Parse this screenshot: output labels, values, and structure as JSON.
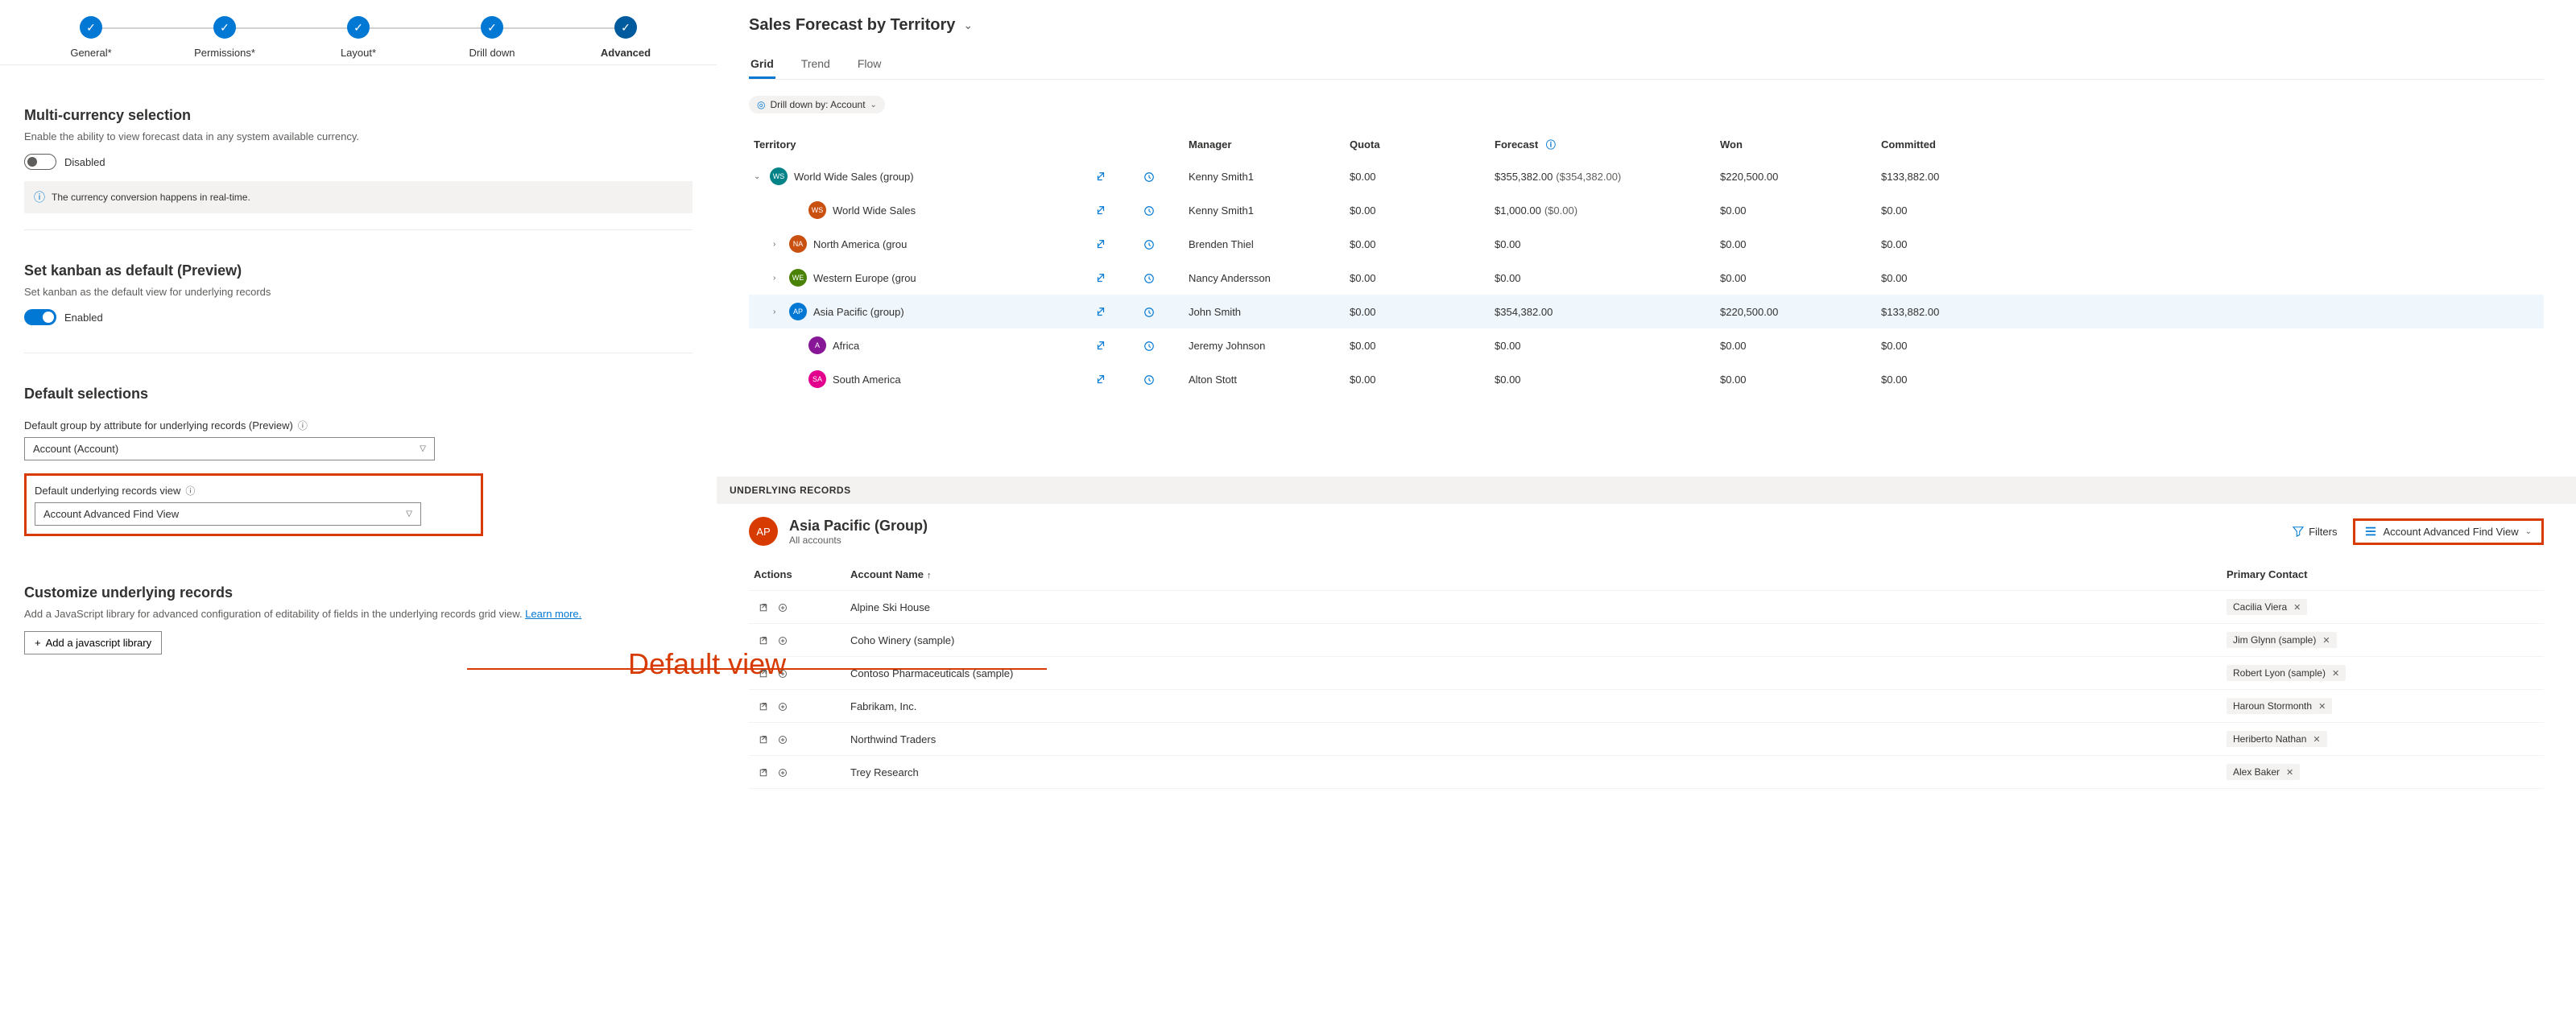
{
  "stepper": {
    "steps": [
      {
        "label": "General*"
      },
      {
        "label": "Permissions*"
      },
      {
        "label": "Layout*"
      },
      {
        "label": "Drill down"
      },
      {
        "label": "Advanced"
      }
    ]
  },
  "multi_currency": {
    "title": "Multi-currency selection",
    "sub": "Enable the ability to view forecast data in any system available currency.",
    "toggle_label": "Disabled",
    "info": "The currency conversion happens in real-time."
  },
  "kanban": {
    "title": "Set kanban as default (Preview)",
    "sub": "Set kanban as the default view for underlying records",
    "toggle_label": "Enabled"
  },
  "default_selections": {
    "title": "Default selections",
    "group_by_label": "Default group by attribute for underlying records (Preview)",
    "group_by_value": "Account (Account)",
    "view_label": "Default underlying records view",
    "view_value": "Account Advanced Find View"
  },
  "customize": {
    "title": "Customize underlying records",
    "sub_a": "Add a JavaScript library for advanced configuration of editability of fields in the underlying records grid view. ",
    "sub_link": "Learn more.",
    "button": "Add a javascript library"
  },
  "annotation": "Default view",
  "forecast": {
    "title": "Sales Forecast by Territory",
    "tabs": [
      {
        "label": "Grid",
        "active": true
      },
      {
        "label": "Trend",
        "active": false
      },
      {
        "label": "Flow",
        "active": false
      }
    ],
    "drill_chip": "Drill down by: Account",
    "columns": {
      "territory": "Territory",
      "manager": "Manager",
      "quota": "Quota",
      "forecast": "Forecast",
      "won": "Won",
      "committed": "Committed"
    },
    "rows": [
      {
        "indent": 1,
        "expand": "down",
        "initials": "WS",
        "avatar_bg": "#038387",
        "name": "World Wide Sales (group)",
        "manager": "Kenny Smith1",
        "quota": "$0.00",
        "forecast": "$355,382.00",
        "forecast2": "($354,382.00)",
        "won": "$220,500.00",
        "committed": "$133,882.00",
        "highlight": false
      },
      {
        "indent": 3,
        "expand": "",
        "initials": "WS",
        "avatar_bg": "#ca5010",
        "name": "World Wide Sales",
        "manager": "Kenny Smith1",
        "quota": "$0.00",
        "forecast": "$1,000.00",
        "forecast2": "($0.00)",
        "won": "$0.00",
        "committed": "$0.00",
        "highlight": false
      },
      {
        "indent": 2,
        "expand": "right",
        "initials": "NA",
        "avatar_bg": "#ca5010",
        "name": "North America (grou",
        "manager": "Brenden Thiel",
        "quota": "$0.00",
        "forecast": "$0.00",
        "forecast2": "",
        "won": "$0.00",
        "committed": "$0.00",
        "highlight": false
      },
      {
        "indent": 2,
        "expand": "right",
        "initials": "WE",
        "avatar_bg": "#498205",
        "name": "Western Europe (grou",
        "manager": "Nancy Andersson",
        "quota": "$0.00",
        "forecast": "$0.00",
        "forecast2": "",
        "won": "$0.00",
        "committed": "$0.00",
        "highlight": false
      },
      {
        "indent": 2,
        "expand": "right",
        "initials": "AP",
        "avatar_bg": "#0078d4",
        "name": "Asia Pacific (group)",
        "manager": "John Smith",
        "quota": "$0.00",
        "forecast": "$354,382.00",
        "forecast2": "",
        "won": "$220,500.00",
        "committed": "$133,882.00",
        "highlight": true
      },
      {
        "indent": 3,
        "expand": "",
        "initials": "A",
        "avatar_bg": "#881798",
        "name": "Africa",
        "manager": "Jeremy Johnson",
        "quota": "$0.00",
        "forecast": "$0.00",
        "forecast2": "",
        "won": "$0.00",
        "committed": "$0.00",
        "highlight": false
      },
      {
        "indent": 3,
        "expand": "",
        "initials": "SA",
        "avatar_bg": "#e3008c",
        "name": "South America",
        "manager": "Alton Stott",
        "quota": "$0.00",
        "forecast": "$0.00",
        "forecast2": "",
        "won": "$0.00",
        "committed": "$0.00",
        "highlight": false
      }
    ]
  },
  "underlying": {
    "header": "UNDERLYING RECORDS",
    "group_initials": "AP",
    "group_title": "Asia Pacific (Group)",
    "group_sub": "All accounts",
    "filters_label": "Filters",
    "view_label": "Account Advanced Find View",
    "columns": {
      "actions": "Actions",
      "account": "Account Name",
      "contact": "Primary Contact"
    },
    "rows": [
      {
        "account": "Alpine Ski House",
        "contact": "Cacilia Viera"
      },
      {
        "account": "Coho Winery (sample)",
        "contact": "Jim Glynn (sample)"
      },
      {
        "account": "Contoso Pharmaceuticals (sample)",
        "contact": "Robert Lyon (sample)"
      },
      {
        "account": "Fabrikam, Inc.",
        "contact": "Haroun Stormonth"
      },
      {
        "account": "Northwind Traders",
        "contact": "Heriberto Nathan"
      },
      {
        "account": "Trey Research",
        "contact": "Alex Baker"
      }
    ]
  }
}
